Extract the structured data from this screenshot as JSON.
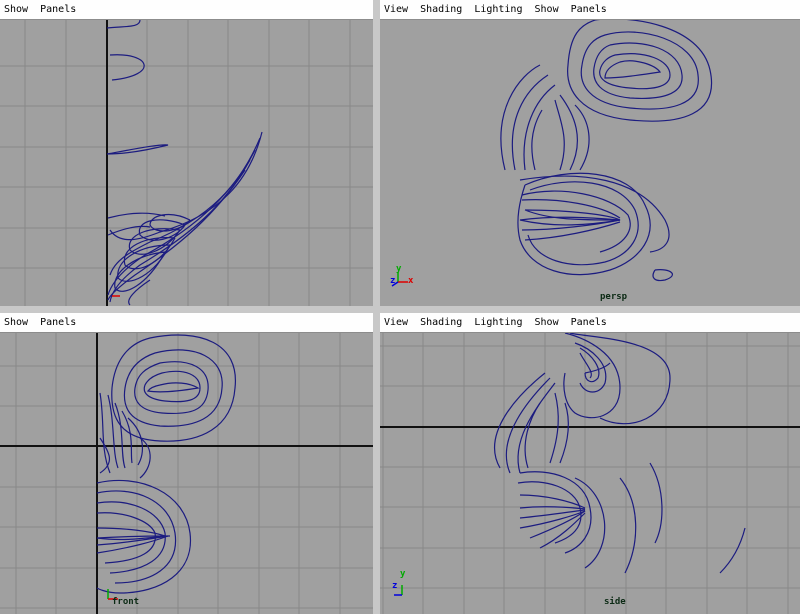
{
  "panels": [
    {
      "menus": [
        "Show",
        "Panels"
      ],
      "camera": ""
    },
    {
      "menus": [
        "View",
        "Shading",
        "Lighting",
        "Show",
        "Panels"
      ],
      "camera": "persp"
    },
    {
      "menus": [
        "Show",
        "Panels"
      ],
      "camera": "front"
    },
    {
      "menus": [
        "View",
        "Shading",
        "Lighting",
        "Show",
        "Panels"
      ],
      "camera": "side"
    }
  ],
  "axis_labels": {
    "x": "x",
    "y": "y",
    "z": "z"
  },
  "colors": {
    "background": "#a0a0a0",
    "grid": "#888888",
    "axis": "#111111",
    "curve": "#1c1c80",
    "menubar": "#fefefe"
  }
}
